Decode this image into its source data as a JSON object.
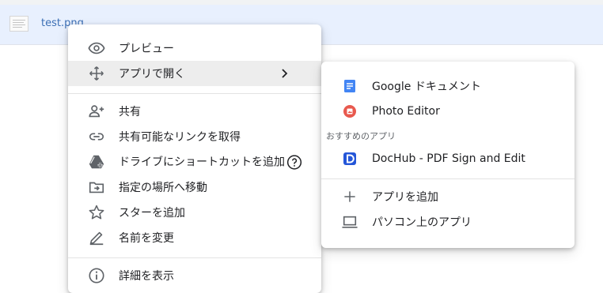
{
  "file": {
    "name": "test.png"
  },
  "context_menu": {
    "items": [
      {
        "label": "プレビュー",
        "icon": "eye-icon"
      },
      {
        "label": "アプリで開く",
        "icon": "open-with-icon",
        "submenu_arrow": "›"
      },
      {
        "label": "共有",
        "icon": "person-add-icon"
      },
      {
        "label": "共有可能なリンクを取得",
        "icon": "link-icon"
      },
      {
        "label": "ドライブにショートカットを追加",
        "icon": "drive-shortcut-icon",
        "help_icon": "help-icon"
      },
      {
        "label": "指定の場所へ移動",
        "icon": "move-to-folder-icon"
      },
      {
        "label": "スターを追加",
        "icon": "star-outline-icon"
      },
      {
        "label": "名前を変更",
        "icon": "pencil-icon"
      },
      {
        "label": "詳細を表示",
        "icon": "info-icon"
      }
    ]
  },
  "open_with_menu": {
    "apps": [
      {
        "label": "Google ドキュメント",
        "icon": "google-docs-icon",
        "color": "#4285f4"
      },
      {
        "label": "Photo Editor",
        "icon": "photo-editor-icon",
        "color": "#e8594e"
      }
    ],
    "suggested_label": "おすすめのアプリ",
    "suggested": [
      {
        "label": "DocHub - PDF Sign and Edit",
        "icon": "dochub-icon",
        "color": "#2456d8"
      }
    ],
    "actions": [
      {
        "label": "アプリを追加",
        "icon": "plus-icon"
      },
      {
        "label": "パソコン上のアプリ",
        "icon": "laptop-icon"
      }
    ]
  },
  "colors": {
    "highlight": "#ededed",
    "file_row": "#e8f0fe",
    "icon_gray": "#5f6368"
  }
}
